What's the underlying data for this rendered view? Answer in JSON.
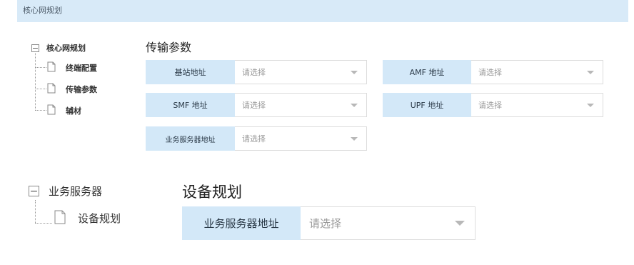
{
  "header": {
    "title": "核心网规划"
  },
  "tree1": {
    "root_label": "核心网规划",
    "items": [
      {
        "label": "终端配置"
      },
      {
        "label": "传输参数"
      },
      {
        "label": "辅材"
      }
    ]
  },
  "section1": {
    "title": "传输参数",
    "fields": [
      {
        "label": "基站地址",
        "placeholder": "请选择"
      },
      {
        "label": "AMF 地址",
        "placeholder": "请选择"
      },
      {
        "label": "SMF 地址",
        "placeholder": "请选择"
      },
      {
        "label": "UPF 地址",
        "placeholder": "请选择"
      },
      {
        "label": "业务服务器地址",
        "placeholder": "请选择"
      }
    ]
  },
  "tree2": {
    "root_label": "业务服务器",
    "items": [
      {
        "label": "设备规划"
      }
    ]
  },
  "section2": {
    "title": "设备规划",
    "fields": [
      {
        "label": "业务服务器地址",
        "placeholder": "请选择"
      }
    ]
  }
}
